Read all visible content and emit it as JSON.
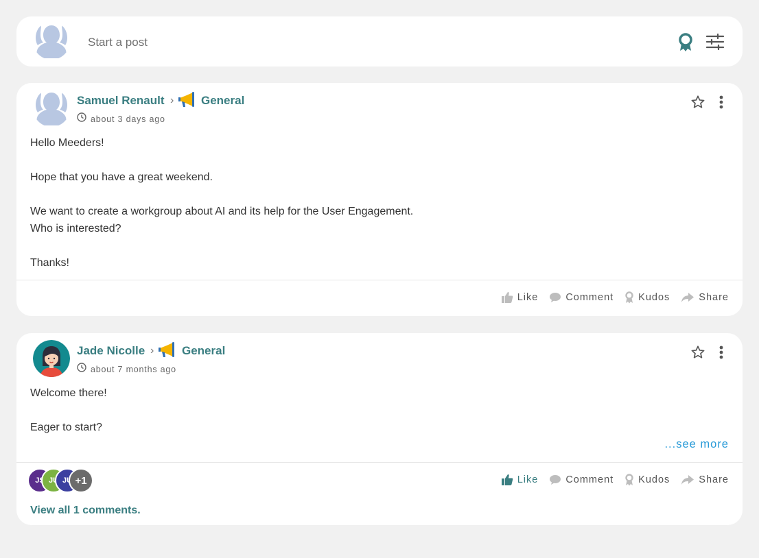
{
  "composer": {
    "placeholder": "Start a post",
    "kudos_icon": "kudos-ribbon-icon",
    "filter_icon": "sliders-icon"
  },
  "colors": {
    "accent": "#3a7e81",
    "link": "#2a9bd8",
    "background": "#f1f1f1",
    "ghost_avatar": "#b8c7e2"
  },
  "posts": [
    {
      "author": "Samuel Renault",
      "separator": "›",
      "space": "General",
      "space_icon": "megaphone-icon",
      "time": "about 3 days ago",
      "body": [
        "Hello Meeders!",
        "",
        "Hope that you have a great weekend.",
        "",
        "We want to create a workgroup about AI and its help for the User Engagement.",
        "Who is interested?",
        "",
        "Thanks!"
      ],
      "actions": {
        "like": "Like",
        "comment": "Comment",
        "kudos": "Kudos",
        "share": "Share"
      }
    },
    {
      "author": "Jade Nicolle",
      "separator": "›",
      "space": "General",
      "space_icon": "megaphone-icon",
      "time": "about 7 months ago",
      "body": [
        "Welcome there!",
        "",
        "Eager to start?"
      ],
      "see_more": "...see more",
      "reactors": [
        {
          "initials": "JS",
          "color": "#5a2d8c"
        },
        {
          "initials": "JU",
          "color": "#7cb342"
        },
        {
          "initials": "JU",
          "color": "#3b3fa0"
        },
        {
          "initials": "+1",
          "color": "#6b6b6b"
        }
      ],
      "view_comments": "View all 1 comments.",
      "actions": {
        "like": "Like",
        "comment": "Comment",
        "kudos": "Kudos",
        "share": "Share"
      }
    }
  ]
}
